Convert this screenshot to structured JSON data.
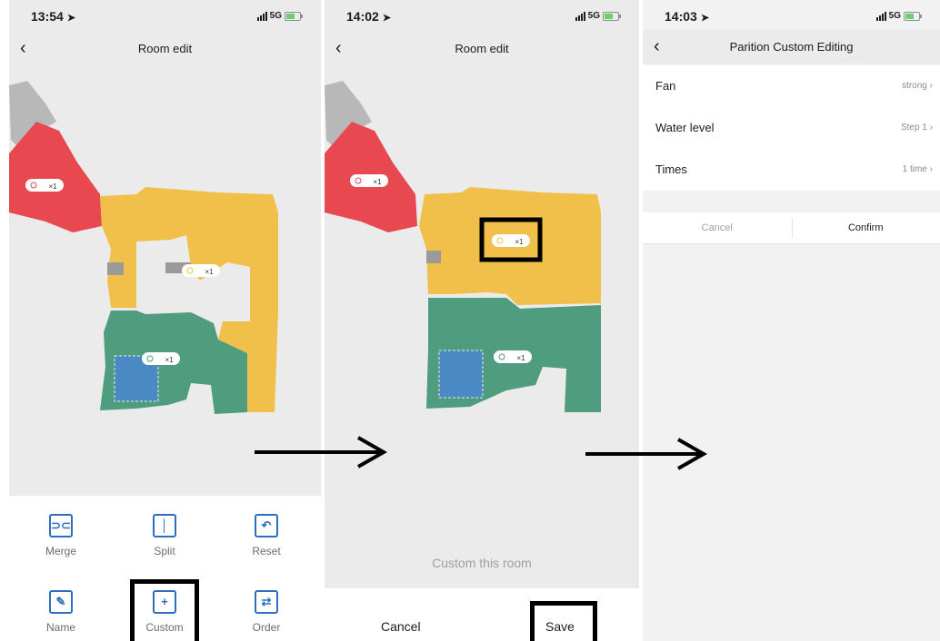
{
  "screen1": {
    "time": "13:54",
    "network": "5G",
    "nav_title": "Room edit",
    "badges": [
      "×1",
      "×1",
      "×1"
    ],
    "tools": [
      {
        "label": "Merge",
        "icon": "merge-icon"
      },
      {
        "label": "Split",
        "icon": "split-icon"
      },
      {
        "label": "Reset",
        "icon": "reset-icon"
      },
      {
        "label": "Name",
        "icon": "name-edit-icon"
      },
      {
        "label": "Custom",
        "icon": "custom-icon"
      },
      {
        "label": "Order",
        "icon": "order-icon"
      }
    ]
  },
  "screen2": {
    "time": "14:02",
    "network": "5G",
    "nav_title": "Room edit",
    "badges": [
      "×1",
      "×1",
      "×1"
    ],
    "hint": "Custom this room",
    "cancel_label": "Cancel",
    "save_label": "Save"
  },
  "screen3": {
    "time": "14:03",
    "network": "5G",
    "nav_title": "Parition Custom Editing",
    "rows": [
      {
        "label": "Fan",
        "value": "strong"
      },
      {
        "label": "Water level",
        "value": "Step 1"
      },
      {
        "label": "Times",
        "value": "1 time"
      }
    ],
    "cancel_label": "Cancel",
    "confirm_label": "Confirm"
  },
  "colors": {
    "room_red": "#e8484f",
    "room_yellow": "#f0c04a",
    "room_green": "#4f9c7f",
    "selection_blue": "#4a86cf",
    "accent_blue": "#2c6fbe"
  }
}
